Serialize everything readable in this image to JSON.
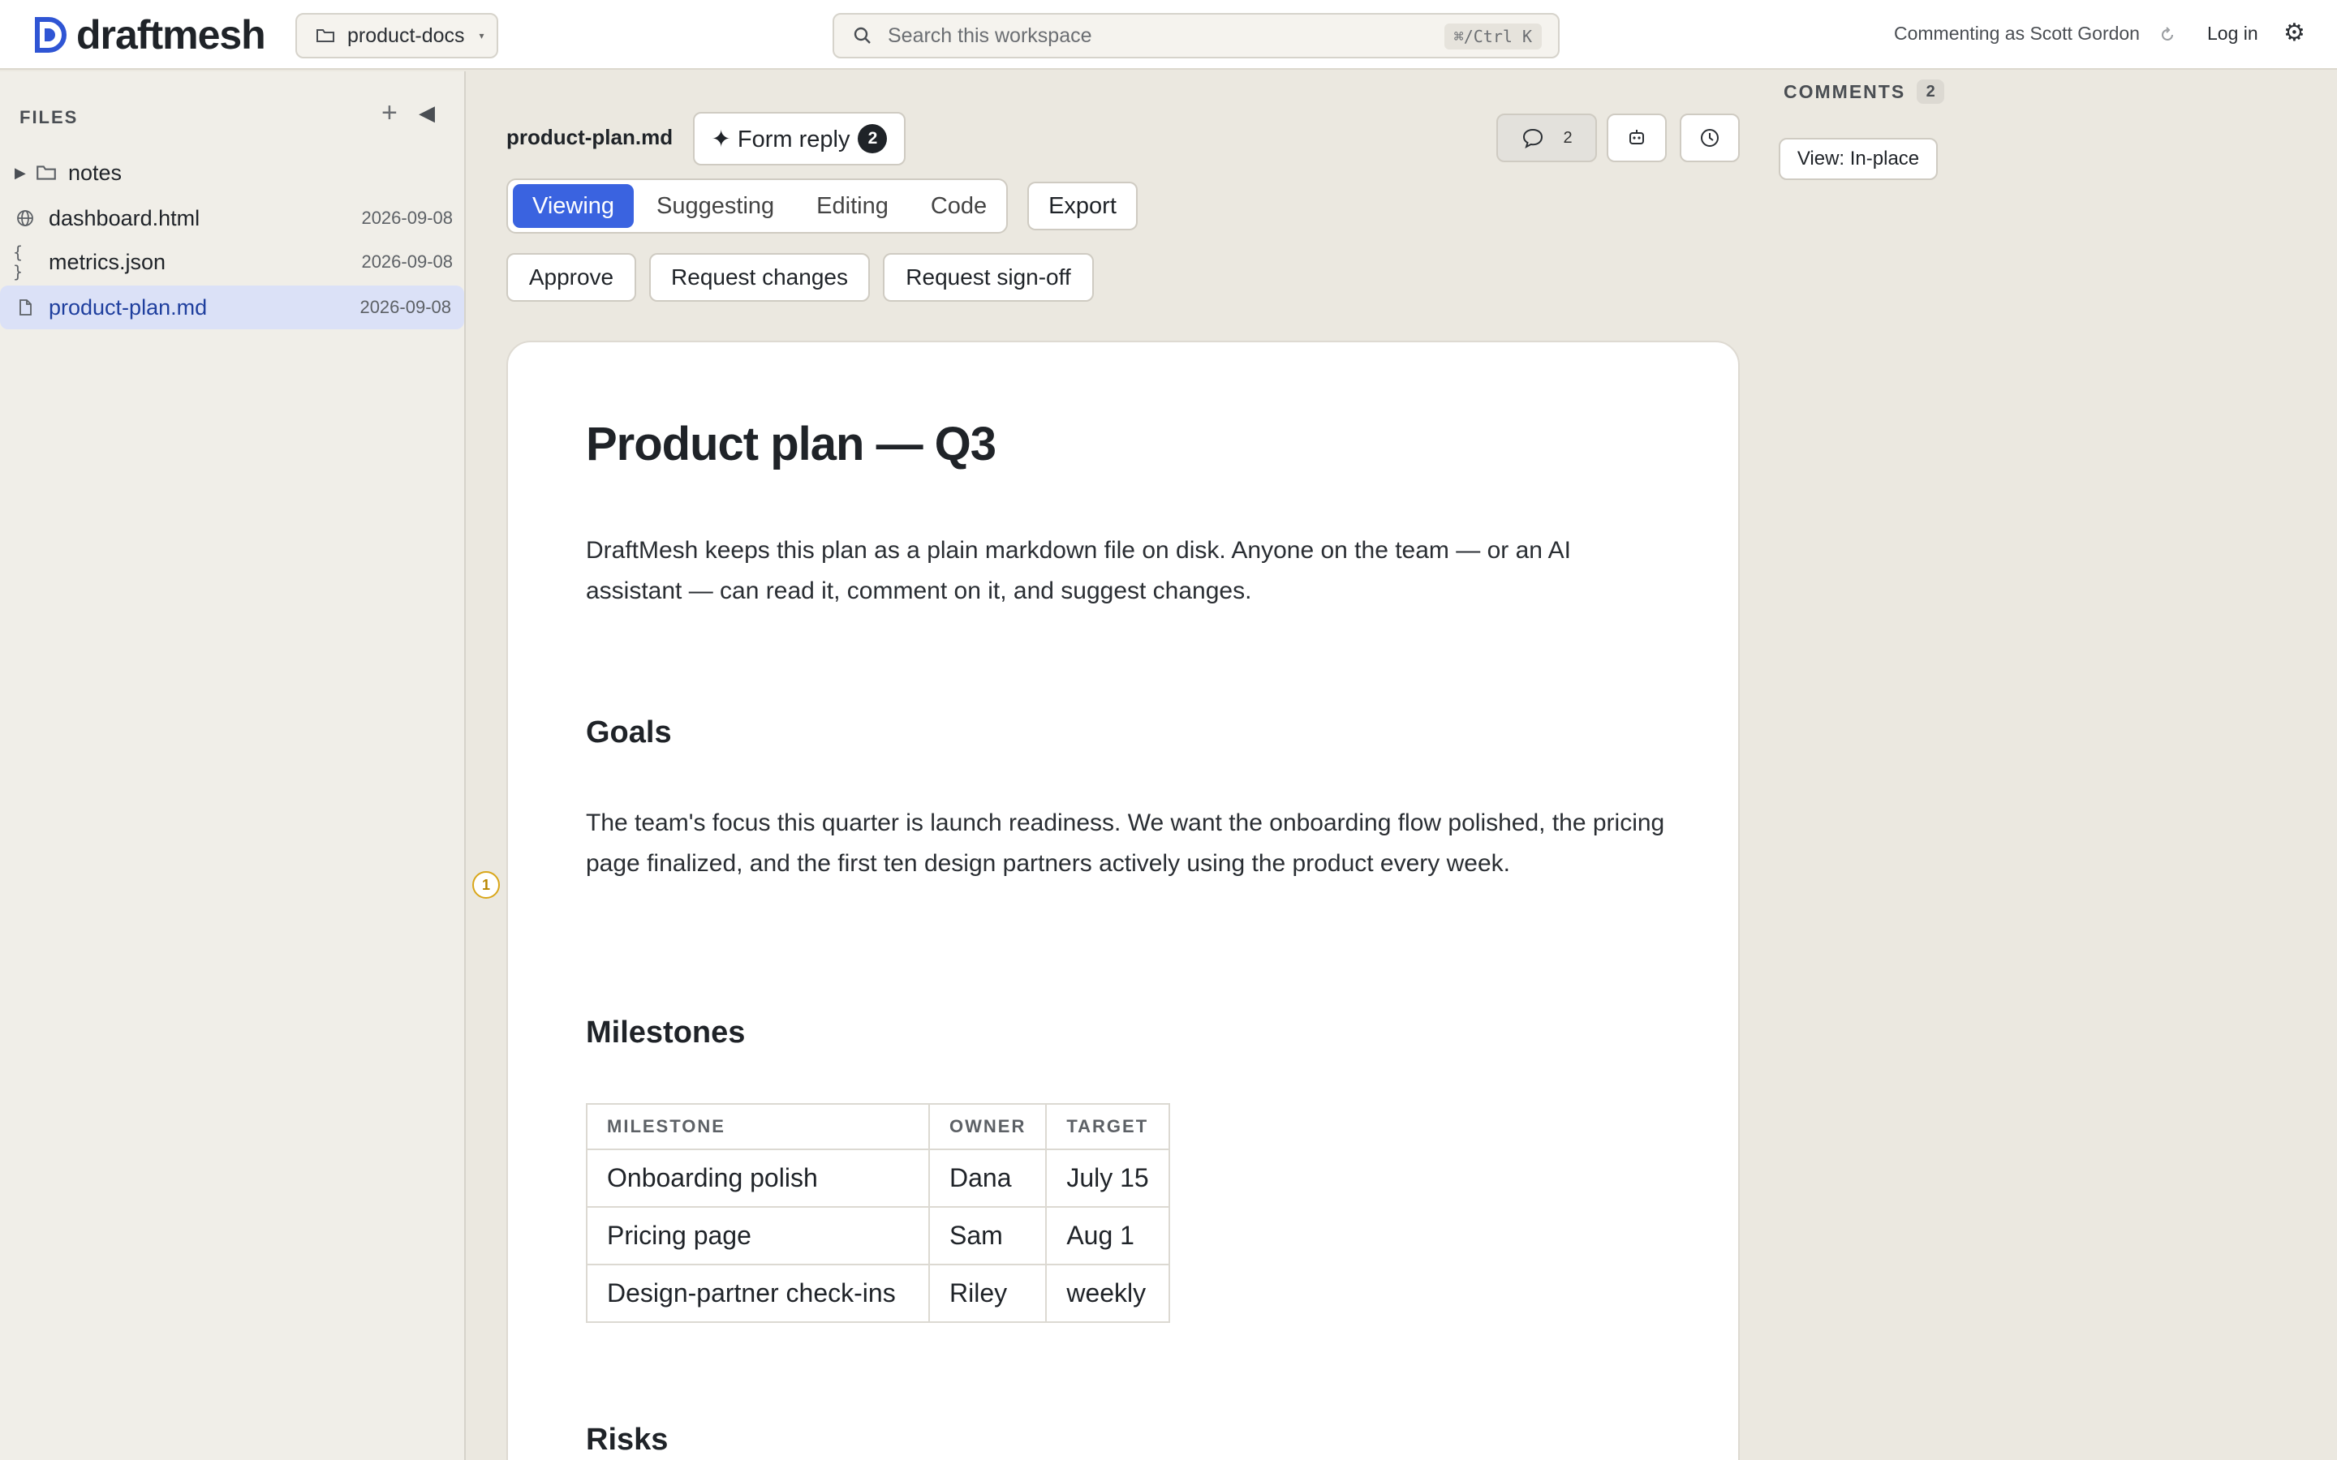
{
  "app": {
    "name": "draftmesh",
    "brand_color": "#2f55d4"
  },
  "topbar": {
    "workspace": "product-docs",
    "search_placeholder": "Search this workspace",
    "search_shortcut": "⌘/Ctrl K",
    "commenting_as": "Commenting as Scott Gordon",
    "login": "Log in",
    "settings_icon": "gear-icon"
  },
  "sidebar": {
    "title": "FILES",
    "add_symbol": "+",
    "collapse_symbol": "◀",
    "folder": {
      "name": "notes",
      "icon": "folder-icon"
    },
    "files": [
      {
        "name": "dashboard.html",
        "date": "2026-09-08",
        "icon": "globe-icon"
      },
      {
        "name": "metrics.json",
        "date": "2026-09-08",
        "icon": "braces-icon"
      },
      {
        "name": "product-plan.md",
        "date": "2026-09-08",
        "icon": "file-icon",
        "selected": true
      }
    ]
  },
  "toolbar": {
    "doc_name": "product-plan.md",
    "form_reply": "✦ Form reply",
    "form_reply_count": "2",
    "comments_count": "2",
    "modes": [
      "Viewing",
      "Suggesting",
      "Editing",
      "Code"
    ],
    "active_mode": "Viewing",
    "export": "Export",
    "actions": [
      "Approve",
      "Request changes",
      "Request sign-off"
    ]
  },
  "document": {
    "title": "Product plan — Q3",
    "intro": "DraftMesh keeps this plan as a plain markdown file on disk. Anyone on the team — or an AI assistant — can read it, comment on it, and suggest changes.",
    "goals_heading": "Goals",
    "goals_text": "The team's focus this quarter is launch readiness. We want the onboarding flow polished, the pricing page finalized, and the first ten design partners actively using the product every week.",
    "milestones_heading": "Milestones",
    "milestones_table": {
      "headers": [
        "MILESTONE",
        "OWNER",
        "TARGET"
      ],
      "rows": [
        [
          "Onboarding polish",
          "Dana",
          "July 15"
        ],
        [
          "Pricing page",
          "Sam",
          "Aug 1"
        ],
        [
          "Design-partner check-ins",
          "Riley",
          "weekly"
        ]
      ]
    },
    "risks_heading": "Risks",
    "comment_marker": "1"
  },
  "comments_panel": {
    "label": "COMMENTS",
    "count": "2",
    "view_button": "View: In-place"
  }
}
